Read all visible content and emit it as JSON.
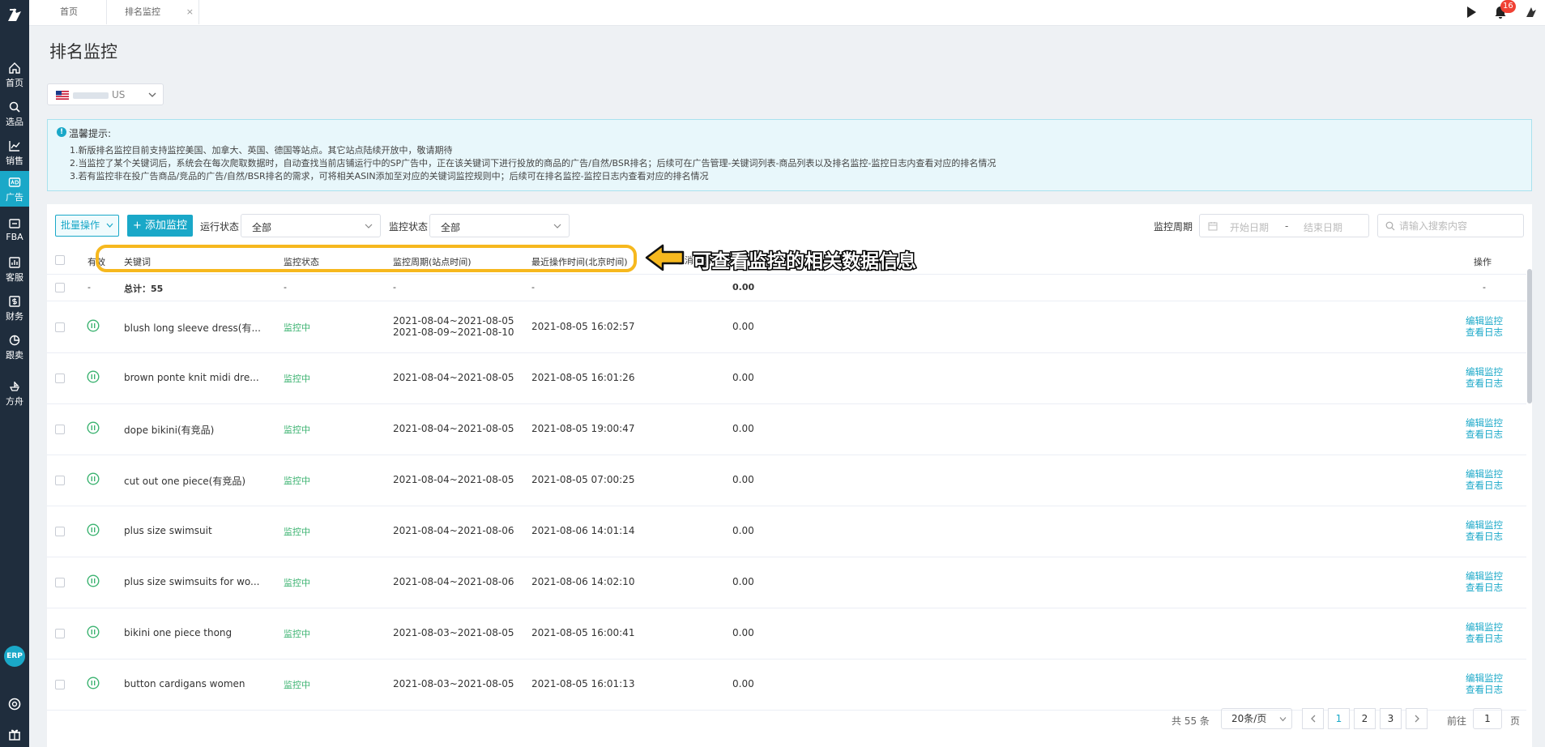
{
  "tabs": [
    {
      "label": "首页"
    },
    {
      "label": "排名监控",
      "close": "×"
    }
  ],
  "sidebar": [
    {
      "label": "首页",
      "icon": "home-icon"
    },
    {
      "label": "选品",
      "icon": "search-icon"
    },
    {
      "label": "销售",
      "icon": "chart-icon"
    },
    {
      "label": "广告",
      "icon": "ad-icon"
    },
    {
      "label": "FBA",
      "icon": "box-icon"
    },
    {
      "label": "客服",
      "icon": "message-icon"
    },
    {
      "label": "财务",
      "icon": "dollar-icon"
    },
    {
      "label": "跟卖",
      "icon": "pie-icon"
    },
    {
      "label": "方舟",
      "icon": "ark-icon"
    }
  ],
  "erp": "ERP",
  "notifications": "16",
  "page_title": "排名监控",
  "site": {
    "suffix": "US"
  },
  "notice": {
    "title": "温馨提示:",
    "lines": [
      "1.新版排名监控目前支持监控美国、加拿大、英国、德国等站点。其它站点陆续开放中，敬请期待",
      "2.当监控了某个关键词后，系统会在每次爬取数据时，自动查找当前店铺运行中的SP广告中，正在该关键词下进行投放的商品的广告/自然/BSR排名；后续可在广告管理-关键词列表-商品列表以及排名监控-监控日志内查看对应的排名情况",
      "3.若有监控非在投广告商品/竞品的广告/自然/BSR排名的需求，可将相关ASIN添加至对应的关键词监控规则中；后续可在排名监控-监控日志内查看对应的排名情况"
    ]
  },
  "toolbar": {
    "batch": "批量操作",
    "add": "+ 添加监控",
    "run_status_label": "运行状态",
    "run_status_value": "全部",
    "monitor_status_label": "监控状态",
    "monitor_status_value": "全部",
    "period_label": "监控周期",
    "start_placeholder": "开始日期",
    "dash": "-",
    "end_placeholder": "结束日期",
    "search_placeholder": "请输入搜索内容"
  },
  "table": {
    "headers": {
      "valid": "有效",
      "keyword": "关键词",
      "status": "监控状态",
      "period": "监控周期(站点时间)",
      "last_op": "最近操作时间(北京时间)",
      "drops": "总消耗的水滴数",
      "op": "操作"
    },
    "total": {
      "dash": "-",
      "label": "总计：55",
      "drops": "0.00"
    },
    "rows": [
      {
        "keyword": "blush long sleeve dress(有...",
        "status": "监控中",
        "period1": "2021-08-04~2021-08-05",
        "period2": "2021-08-09~2021-08-10",
        "last_op": "2021-08-05 16:02:57",
        "drops": "0.00"
      },
      {
        "keyword": "brown ponte knit midi dre...",
        "status": "监控中",
        "period1": "2021-08-04~2021-08-05",
        "period2": "",
        "last_op": "2021-08-05 16:01:26",
        "drops": "0.00"
      },
      {
        "keyword": "dope bikini(有竞品)",
        "status": "监控中",
        "period1": "2021-08-04~2021-08-05",
        "period2": "",
        "last_op": "2021-08-05 19:00:47",
        "drops": "0.00"
      },
      {
        "keyword": "cut out one piece(有竞品)",
        "status": "监控中",
        "period1": "2021-08-04~2021-08-05",
        "period2": "",
        "last_op": "2021-08-05 07:00:25",
        "drops": "0.00"
      },
      {
        "keyword": "plus size swimsuit",
        "status": "监控中",
        "period1": "2021-08-04~2021-08-06",
        "period2": "",
        "last_op": "2021-08-06 14:01:14",
        "drops": "0.00"
      },
      {
        "keyword": "plus size swimsuits for wo...",
        "status": "监控中",
        "period1": "2021-08-04~2021-08-06",
        "period2": "",
        "last_op": "2021-08-06 14:02:10",
        "drops": "0.00"
      },
      {
        "keyword": "bikini one piece thong",
        "status": "监控中",
        "period1": "2021-08-03~2021-08-05",
        "period2": "",
        "last_op": "2021-08-05 16:00:41",
        "drops": "0.00"
      },
      {
        "keyword": "button cardigans women",
        "status": "监控中",
        "period1": "2021-08-03~2021-08-05",
        "period2": "",
        "last_op": "2021-08-05 16:01:13",
        "drops": "0.00"
      }
    ],
    "actions": {
      "edit": "编辑监控",
      "log": "查看日志"
    }
  },
  "callout": "可查看监控的相关数据信息",
  "pagination": {
    "total": "共 55 条",
    "size": "20条/页",
    "pages": [
      "1",
      "2",
      "3"
    ],
    "goto": "前往",
    "current": "1",
    "page": "页"
  },
  "colors": {
    "accent": "#1aa8c8",
    "sidebar": "#1f2d3d",
    "status_green": "#3cb371",
    "highlight": "#f6b81e"
  }
}
